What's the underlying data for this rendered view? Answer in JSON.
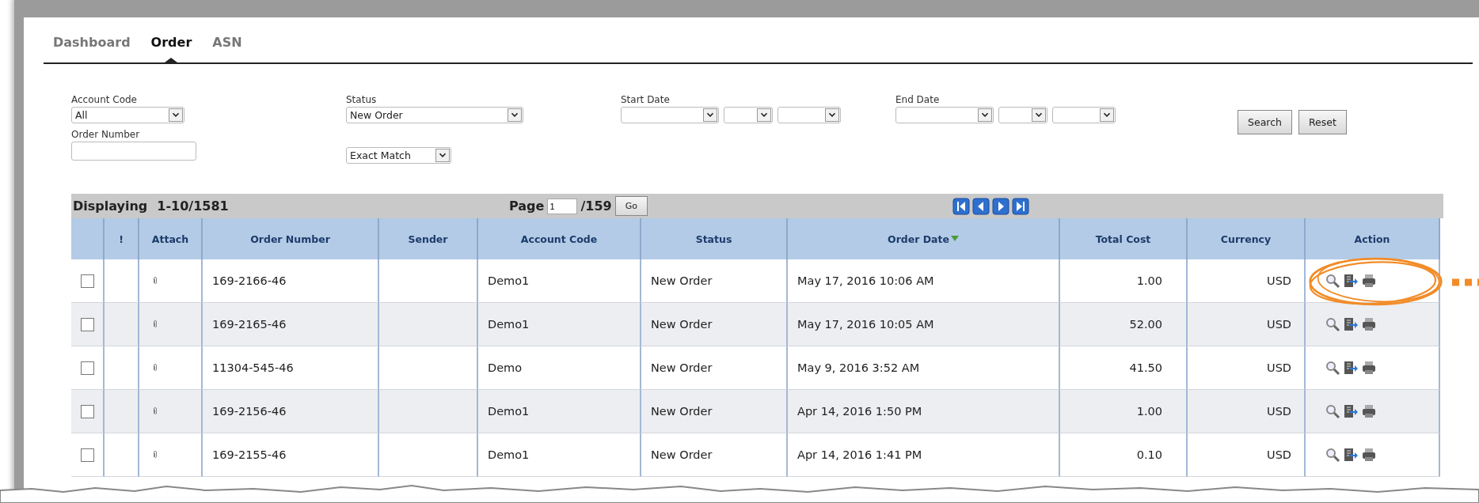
{
  "tabs": [
    {
      "label": "Dashboard",
      "selected": false
    },
    {
      "label": "Order",
      "selected": true
    },
    {
      "label": "ASN",
      "selected": false
    }
  ],
  "filters": {
    "account_code": {
      "label": "Account Code",
      "value": "All"
    },
    "status": {
      "label": "Status",
      "value": "New Order"
    },
    "start_date": {
      "label": "Start Date"
    },
    "end_date": {
      "label": "End Date"
    },
    "order_number": {
      "label": "Order Number"
    },
    "match": {
      "value": "Exact Match"
    }
  },
  "buttons": [
    "Search",
    "Reset"
  ],
  "pager": {
    "displaying_label": "Displaying",
    "range": "1-10/1581",
    "page_label": "Page",
    "page": "1",
    "total_pages": "/159",
    "go": "Go"
  },
  "table": {
    "columns": [
      {
        "label": "!",
        "sorted": false
      },
      {
        "label": "Attach",
        "sorted": false
      },
      {
        "label": "Order Number",
        "sorted": false
      },
      {
        "label": "Sender",
        "sorted": false
      },
      {
        "label": "Account Code",
        "sorted": false
      },
      {
        "label": "Status",
        "sorted": false
      },
      {
        "label": "Order Date",
        "sorted": true
      },
      {
        "label": "Total Cost",
        "sorted": false
      },
      {
        "label": "Currency",
        "sorted": false
      },
      {
        "label": "Action",
        "sorted": false
      }
    ],
    "rows": [
      {
        "checked": false,
        "order_number": "169-2166-46",
        "account_code": "Demo1",
        "status": "New Order",
        "order_date": "May 17, 2016 10:06 AM",
        "total_cost": "1.00",
        "currency": "USD"
      },
      {
        "checked": false,
        "order_number": "169-2165-46",
        "account_code": "Demo1",
        "status": "New Order",
        "order_date": "May 17, 2016 10:05 AM",
        "total_cost": "52.00",
        "currency": "USD"
      },
      {
        "checked": false,
        "order_number": "11304-545-46",
        "account_code": "Demo",
        "status": "New Order",
        "order_date": "May 9, 2016 3:52 AM",
        "total_cost": "41.50",
        "currency": "USD"
      },
      {
        "checked": false,
        "order_number": "169-2156-46",
        "account_code": "Demo1",
        "status": "New Order",
        "order_date": "Apr 14, 2016 1:50 PM",
        "total_cost": "1.00",
        "currency": "USD"
      },
      {
        "checked": false,
        "order_number": "169-2155-46",
        "account_code": "Demo1",
        "status": "New Order",
        "order_date": "Apr 14, 2016 1:41 PM",
        "total_cost": "0.10",
        "currency": "USD"
      }
    ]
  }
}
